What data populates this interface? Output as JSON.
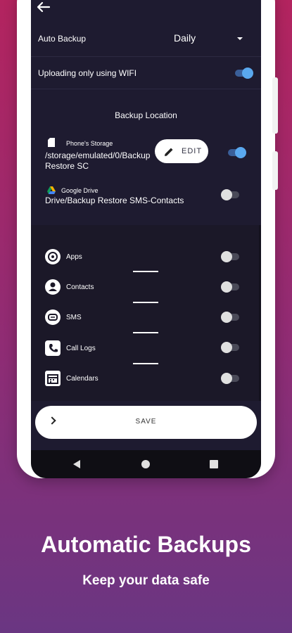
{
  "auto_backup": {
    "label": "Auto Backup",
    "value": "Daily"
  },
  "wifi_only": {
    "label": "Uploading only using WIFI",
    "enabled": true
  },
  "backup_location": {
    "title": "Backup Location",
    "phone_storage": {
      "title": "Phone's Storage",
      "path_line1": "/storage/emulated/0/Backup",
      "path_line2": "Restore SC",
      "enabled": true,
      "edit_label": "EDIT"
    },
    "google_drive": {
      "title": "Google Drive",
      "path": "Drive/Backup Restore SMS-Contacts",
      "enabled": false
    }
  },
  "items": [
    {
      "label": "Apps",
      "icon": "apps-icon",
      "enabled": false
    },
    {
      "label": "Contacts",
      "icon": "contacts-icon",
      "enabled": false
    },
    {
      "label": "SMS",
      "icon": "sms-icon",
      "enabled": false
    },
    {
      "label": "Call Logs",
      "icon": "call-logs-icon",
      "enabled": false
    },
    {
      "label": "Calendars",
      "icon": "calendar-icon",
      "enabled": false
    }
  ],
  "save_label": "SAVE",
  "promo": {
    "headline": "Automatic Backups",
    "subline": "Keep your data safe"
  },
  "colors": {
    "accent": "#5aa8ee",
    "background_top": "#b3245f",
    "background_bottom": "#6a3682",
    "screen": "#1e1b30"
  }
}
